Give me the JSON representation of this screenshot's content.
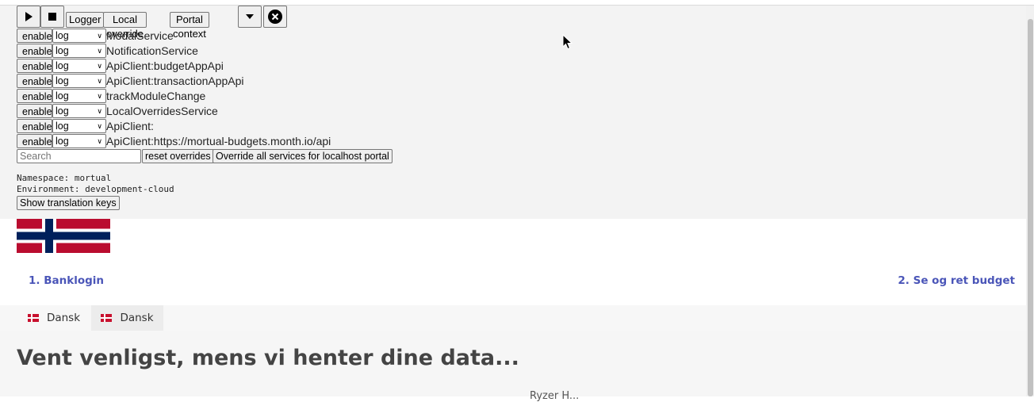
{
  "toolbar": {
    "play_icon": "play-icon",
    "stop_icon": "stop-icon",
    "logger_label": "Logger",
    "local_override_label": "Local override",
    "portal_context_label": "Portal context",
    "dropdown_icon": "caret-down-icon",
    "close_icon": "close-circle-icon"
  },
  "services": [
    {
      "enable_label": "enable",
      "level": "log",
      "name": "ModalService"
    },
    {
      "enable_label": "enable",
      "level": "log",
      "name": "NotificationService"
    },
    {
      "enable_label": "enable",
      "level": "log",
      "name": "ApiClient:budgetAppApi"
    },
    {
      "enable_label": "enable",
      "level": "log",
      "name": "ApiClient:transactionAppApi"
    },
    {
      "enable_label": "enable",
      "level": "log",
      "name": "trackModuleChange"
    },
    {
      "enable_label": "enable",
      "level": "log",
      "name": "LocalOverridesService"
    },
    {
      "enable_label": "enable",
      "level": "log",
      "name": "ApiClient:"
    },
    {
      "enable_label": "enable",
      "level": "log",
      "name": "ApiClient:https://mortual-budgets.month.io/api"
    }
  ],
  "search": {
    "placeholder": "Search",
    "value": ""
  },
  "reset_label": "reset overrides",
  "override_all_label": "Override all services for localhost portal",
  "namespace_line": "Namespace: mortual",
  "environment_line": "Environment: development-cloud",
  "show_keys_label": "Show translation keys",
  "steps": {
    "step1": "1. Banklogin",
    "step2": "2. Se og ret budget"
  },
  "languages": [
    {
      "label": "Dansk",
      "icon": "denmark-flag-icon"
    },
    {
      "label": "Dansk",
      "icon": "denmark-flag-icon"
    }
  ],
  "main": {
    "title": "Vent venligst, mens vi henter dine data...",
    "partial_text": "Ryzer H..."
  },
  "colors": {
    "accent": "#4a55b8",
    "flag_red": "#ba0c2f",
    "flag_blue": "#00205b"
  }
}
